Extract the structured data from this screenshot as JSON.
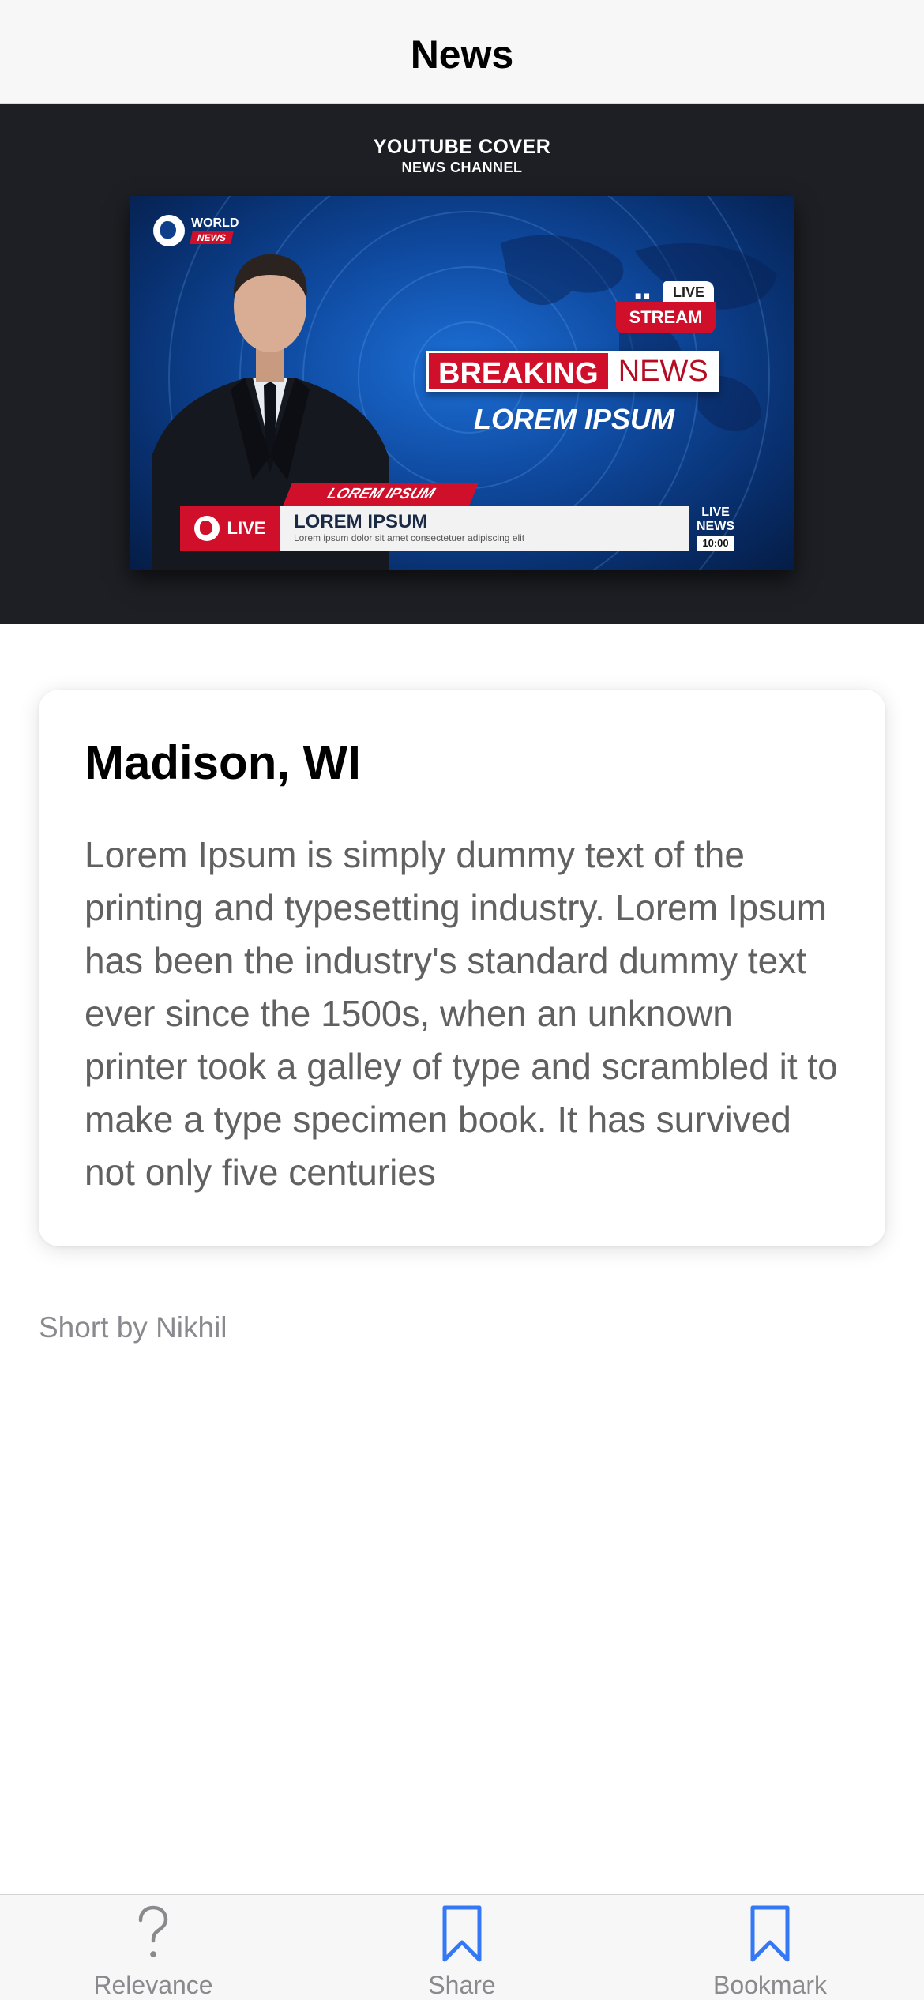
{
  "nav": {
    "title": "News"
  },
  "hero": {
    "cover_title": "YOUTUBE COVER",
    "cover_subtitle": "NEWS CHANNEL",
    "thumbnail": {
      "logo_word": "WORLD",
      "logo_tag": "NEWS",
      "live_label": "LIVE",
      "stream_label": "STREAM",
      "breaking": "BREAKING",
      "news": "NEWS",
      "headline": "LOREM IPSUM",
      "lower_tag": "LOREM IPSUM",
      "ticker_live": "LIVE",
      "ticker_headline": "LOREM IPSUM",
      "ticker_sub": "Lorem ipsum dolor sit amet consectetuer adipiscing elit",
      "live_news_1": "LIVE",
      "live_news_2": "NEWS",
      "live_news_time": "10:00"
    },
    "colors": {
      "accent_red": "#d0102a",
      "navy": "#0f4aa0"
    }
  },
  "article": {
    "title": "Madison, WI",
    "body": "Lorem Ipsum is simply dummy text of the printing and typesetting industry. Lorem Ipsum has been the industry's standard dummy text ever since the 1500s, when an unknown printer took a galley of type and scrambled it to make a type specimen book. It has survived not only five centuries",
    "byline": "Short by Nikhil"
  },
  "tabs": [
    {
      "label": "Relevance",
      "icon": "question-icon",
      "color": "#8a8a8e"
    },
    {
      "label": "Share",
      "icon": "bookmark-icon",
      "color": "#3478f6"
    },
    {
      "label": "Bookmark",
      "icon": "bookmark-icon",
      "color": "#3478f6"
    }
  ]
}
